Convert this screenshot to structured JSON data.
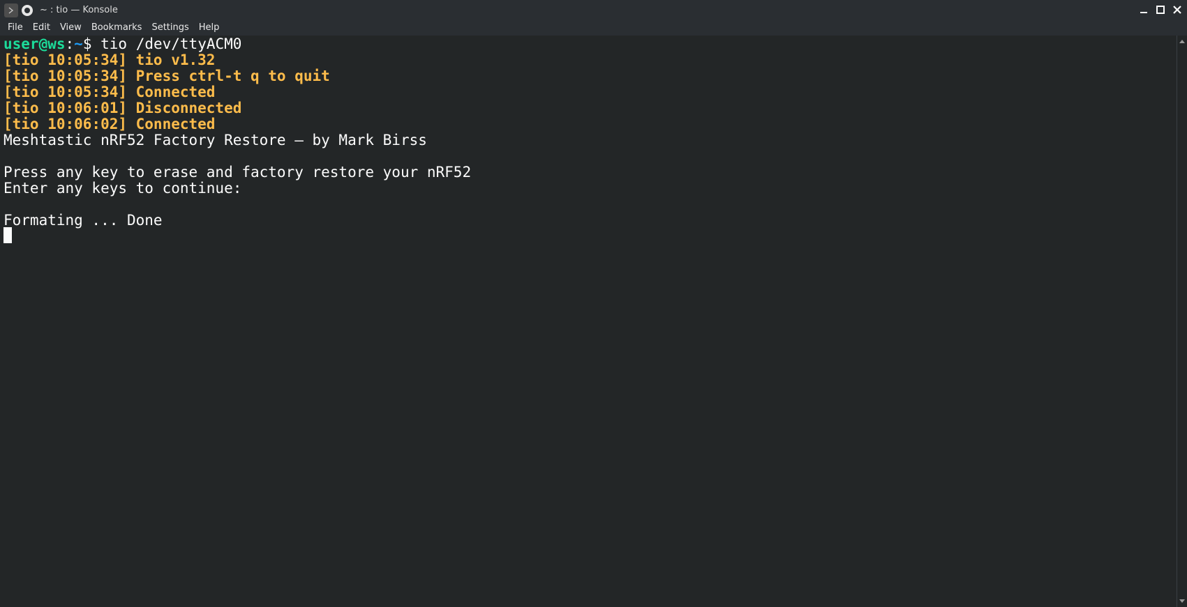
{
  "window": {
    "title": "~ : tio — Konsole"
  },
  "menu": {
    "items": [
      "File",
      "Edit",
      "View",
      "Bookmarks",
      "Settings",
      "Help"
    ]
  },
  "terminal": {
    "prompt": {
      "user_host": "user@ws",
      "colon": ":",
      "path": "~",
      "dollar": "$",
      "command": " tio /dev/ttyACM0"
    },
    "lines": [
      "[tio 10:05:34] tio v1.32",
      "[tio 10:05:34] Press ctrl-t q to quit",
      "[tio 10:05:34] Connected",
      "[tio 10:06:01] Disconnected",
      "[tio 10:06:02] Connected",
      "Meshtastic nRF52 Factory Restore – by Mark Birss",
      "",
      "Press any key to erase and factory restore your nRF52",
      "Enter any keys to continue:",
      "",
      "Formating ... Done"
    ]
  },
  "colors": {
    "background": "#232627",
    "prompt_user": "#1cdc9a",
    "prompt_path": "#1d99f3",
    "tio_message": "#fdbc4b",
    "text": "#fcfcfc"
  },
  "icons": {
    "app": "konsole-terminal-icon",
    "pin": "pin-icon",
    "minimize": "minimize-icon",
    "maximize": "maximize-icon",
    "close": "close-icon"
  }
}
